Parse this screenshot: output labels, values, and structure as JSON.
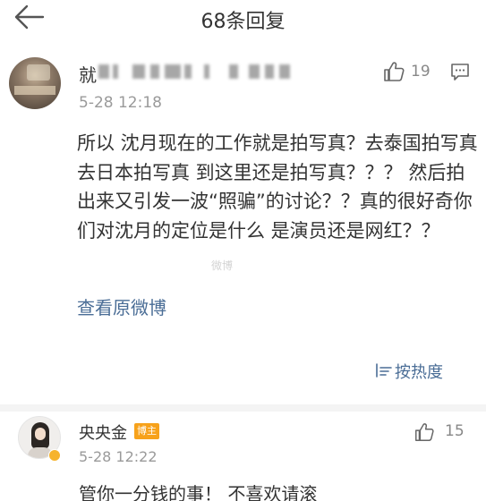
{
  "header": {
    "title": "68条回复",
    "back_icon": "arrow-left-icon"
  },
  "main_comment": {
    "username_visible": "就",
    "time": "5-28 12:18",
    "like_count": "19",
    "text": "所以 沈月现在的工作就是拍写真？去泰国拍写真去日本拍写真 到这里还是拍写真？？？ 然后拍出来又引发一波“照骗”的讨论？？真的很好奇你们对沈月的定位是什么 是演员还是网红？？",
    "watermark": "微博",
    "view_original": "查看原微博",
    "sort_label": "按热度"
  },
  "reply": {
    "name": "央央金",
    "badge": "博主",
    "time": "5-28 12:22",
    "like_count": "15",
    "text": "管你一分钱的事！ 不喜欢请滚"
  },
  "colors": {
    "link": "#4a6d96",
    "badge": "#f7a21b",
    "meta": "#9a9a9a"
  }
}
